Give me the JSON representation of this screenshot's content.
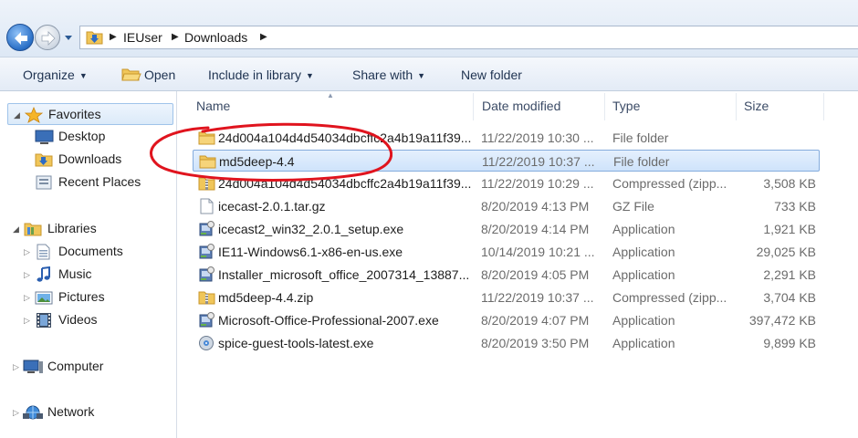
{
  "address": {
    "crumbs": [
      "IEUser",
      "Downloads"
    ]
  },
  "toolbar": {
    "organize": "Organize",
    "open": "Open",
    "include": "Include in library",
    "share": "Share with",
    "newfolder": "New folder"
  },
  "nav": {
    "favorites": "Favorites",
    "desktop": "Desktop",
    "downloads": "Downloads",
    "recent": "Recent Places",
    "libraries": "Libraries",
    "documents": "Documents",
    "music": "Music",
    "pictures": "Pictures",
    "videos": "Videos",
    "computer": "Computer",
    "network": "Network"
  },
  "columns": {
    "name": "Name",
    "date": "Date modified",
    "type": "Type",
    "size": "Size"
  },
  "files": [
    {
      "name": "24d004a104d4d54034dbcffc2a4b19a11f39...",
      "date": "11/22/2019 10:30 ...",
      "type": "File folder",
      "size": "",
      "icon": "folder-icon"
    },
    {
      "name": "md5deep-4.4",
      "date": "11/22/2019 10:37 ...",
      "type": "File folder",
      "size": "",
      "icon": "folder-icon",
      "selected": true
    },
    {
      "name": "24d004a104d4d54034dbcffc2a4b19a11f39...",
      "date": "11/22/2019 10:29 ...",
      "type": "Compressed (zipp...",
      "size": "3,508 KB",
      "icon": "zip-folder-icon"
    },
    {
      "name": "icecast-2.0.1.tar.gz",
      "date": "8/20/2019 4:13 PM",
      "type": "GZ File",
      "size": "733 KB",
      "icon": "blank-file-icon"
    },
    {
      "name": "icecast2_win32_2.0.1_setup.exe",
      "date": "8/20/2019 4:14 PM",
      "type": "Application",
      "size": "1,921 KB",
      "icon": "installer-icon"
    },
    {
      "name": "IE11-Windows6.1-x86-en-us.exe",
      "date": "10/14/2019 10:21 ...",
      "type": "Application",
      "size": "29,025 KB",
      "icon": "installer-icon"
    },
    {
      "name": "Installer_microsoft_office_2007314_13887...",
      "date": "8/20/2019 4:05 PM",
      "type": "Application",
      "size": "2,291 KB",
      "icon": "installer-icon"
    },
    {
      "name": "md5deep-4.4.zip",
      "date": "11/22/2019 10:37 ...",
      "type": "Compressed (zipp...",
      "size": "3,704 KB",
      "icon": "zip-folder-icon"
    },
    {
      "name": "Microsoft-Office-Professional-2007.exe",
      "date": "8/20/2019 4:07 PM",
      "type": "Application",
      "size": "397,472 KB",
      "icon": "installer-icon"
    },
    {
      "name": "spice-guest-tools-latest.exe",
      "date": "8/20/2019 3:50 PM",
      "type": "Application",
      "size": "9,899 KB",
      "icon": "disc-app-icon"
    }
  ],
  "colors": {
    "selection": "#cfe3fb",
    "annotation": "#e0141e"
  }
}
